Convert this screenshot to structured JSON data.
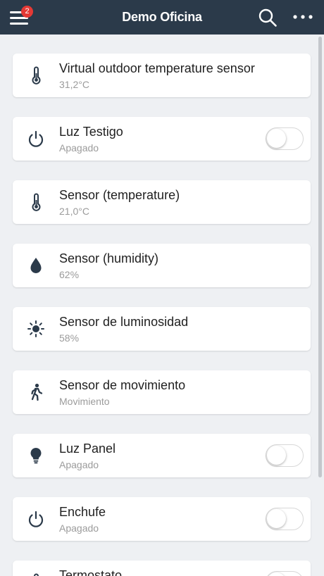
{
  "header": {
    "title": "Demo Oficina",
    "notification_count": "2"
  },
  "devices": [
    {
      "name": "Virtual outdoor temperature sensor",
      "state": "31,2°C",
      "icon": "thermometer-icon"
    },
    {
      "name": "Luz Testigo",
      "state": "Apagado",
      "icon": "power-icon",
      "toggle_on": false
    },
    {
      "name": "Sensor (temperature)",
      "state": "21,0°C",
      "icon": "thermometer-icon"
    },
    {
      "name": "Sensor (humidity)",
      "state": "62%",
      "icon": "water-drop-icon"
    },
    {
      "name": "Sensor de luminosidad",
      "state": "58%",
      "icon": "sun-icon"
    },
    {
      "name": "Sensor de movimiento",
      "state": "Movimiento",
      "icon": "walking-person-icon"
    },
    {
      "name": "Luz Panel",
      "state": "Apagado",
      "icon": "lightbulb-icon",
      "toggle_on": false
    },
    {
      "name": "Enchufe",
      "state": "Apagado",
      "icon": "power-icon",
      "toggle_on": false
    },
    {
      "name": "Termostato",
      "state": "",
      "icon": "thermometer-icon",
      "toggle_on": false
    }
  ],
  "colors": {
    "header_bg": "#2b3a4a",
    "badge": "#e53935",
    "icon": "#2b3a4a",
    "background": "#eef0f3"
  }
}
